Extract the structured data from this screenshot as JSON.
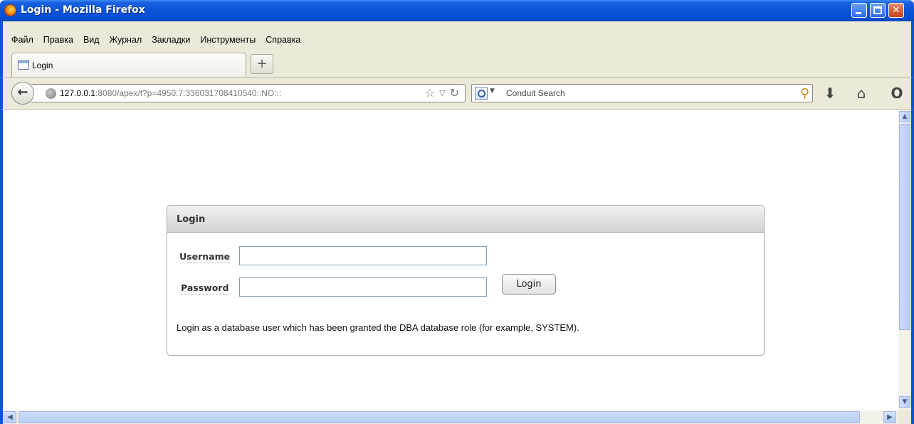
{
  "window": {
    "title": "Login - Mozilla Firefox",
    "minimize_label": "",
    "maximize_label": "",
    "close_label": "✕"
  },
  "menu": {
    "items": [
      "Файл",
      "Правка",
      "Вид",
      "Журнал",
      "Закладки",
      "Инструменты",
      "Справка"
    ]
  },
  "tabs": {
    "active_label": "Login",
    "new_tab_label": "+"
  },
  "navbar": {
    "url_host": "127.0.0.1",
    "url_rest": ":8080/apex/f?p=4950:7:336031708410540::NO:::",
    "search_placeholder": "Conduit Search",
    "back_icon": "back-arrow-icon",
    "bookmark_icon": "star-icon",
    "reload_icon": "reload-icon",
    "download_icon": "download-icon",
    "home_icon": "home-icon",
    "addon_icon": "opera-like-ring-icon"
  },
  "login": {
    "title": "Login",
    "username_label": "Username",
    "username_value": "",
    "password_label": "Password",
    "password_value": "",
    "button_label": "Login",
    "hint": "Login as a database user which has been granted the DBA database role (for example, SYSTEM)."
  },
  "colors": {
    "titlebar": "#0a53d9",
    "chrome": "#ece9d8",
    "scroll_accent": "#b8cdf3",
    "input_border": "#7f9db9"
  }
}
